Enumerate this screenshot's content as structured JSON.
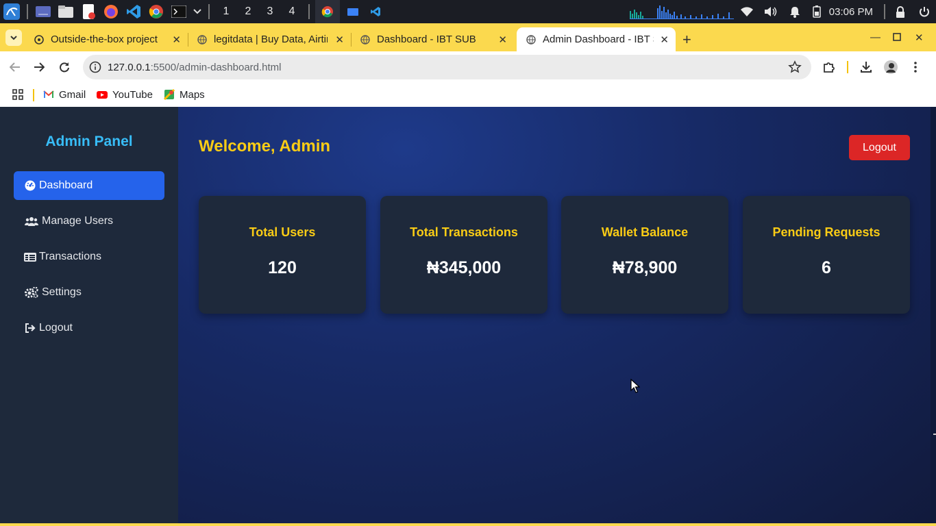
{
  "taskbar": {
    "workspaces": [
      "1",
      "2",
      "3",
      "4"
    ],
    "clock": "03:06 PM",
    "apps": [
      "kali-menu-icon",
      "desktop-icon",
      "file-manager-icon",
      "text-editor-icon",
      "firefox-icon",
      "vscode-icon",
      "chrome-icon",
      "terminal-icon"
    ]
  },
  "browser": {
    "tabs": [
      {
        "title": "Outside-the-box project",
        "active": false
      },
      {
        "title": "legitdata | Buy Data, Airtime",
        "active": false
      },
      {
        "title": "Dashboard - IBT SUB",
        "active": false
      },
      {
        "title": "Admin Dashboard - IBT SUB",
        "active": true
      }
    ],
    "url_host": "127.0.0.1",
    "url_path": ":5500/admin-dashboard.html",
    "bookmarks": [
      "Gmail",
      "YouTube",
      "Maps"
    ]
  },
  "sidebar": {
    "title": "Admin Panel",
    "items": [
      {
        "label": "Dashboard",
        "icon": "dashboard-gauge-icon",
        "active": true
      },
      {
        "label": "Manage Users",
        "icon": "users-icon",
        "active": false
      },
      {
        "label": "Transactions",
        "icon": "id-card-icon",
        "active": false
      },
      {
        "label": "Settings",
        "icon": "gears-icon",
        "active": false
      },
      {
        "label": "Logout",
        "icon": "sign-out-icon",
        "active": false
      }
    ]
  },
  "header": {
    "welcome": "Welcome, Admin",
    "logout_label": "Logout"
  },
  "stats": [
    {
      "title": "Total Users",
      "value": "120"
    },
    {
      "title": "Total Transactions",
      "value": "₦345,000"
    },
    {
      "title": "Wallet Balance",
      "value": "₦78,900"
    },
    {
      "title": "Pending Requests",
      "value": "6"
    }
  ],
  "colors": {
    "sidebar_bg": "#1e293b",
    "accent_blue": "#2563eb",
    "title_cyan": "#38bdf8",
    "heading_yellow": "#facc15",
    "logout_red": "#dc2626",
    "chrome_theme": "#fbd94e"
  }
}
